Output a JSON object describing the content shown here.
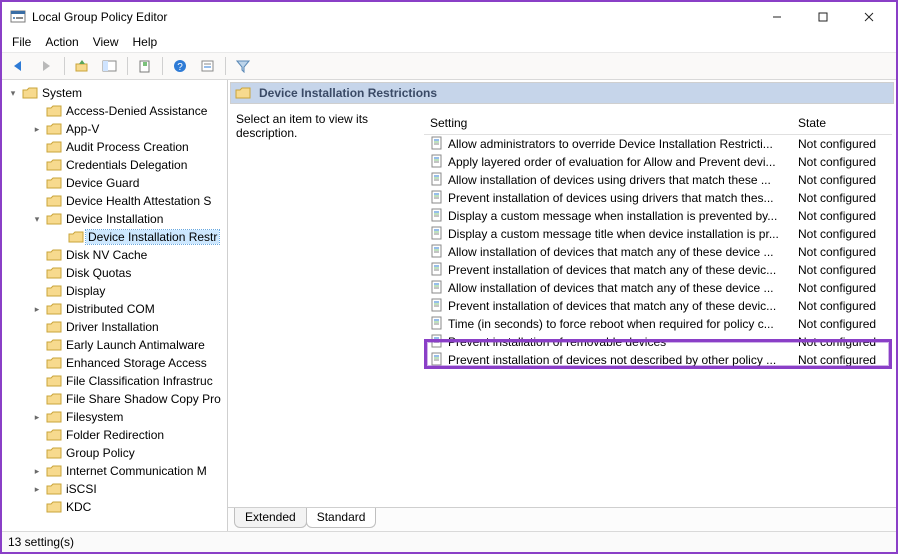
{
  "window": {
    "title": "Local Group Policy Editor"
  },
  "menu": {
    "file": "File",
    "action": "Action",
    "view": "View",
    "help": "Help"
  },
  "tree": {
    "root": "System",
    "root_expanded": true,
    "items": [
      {
        "label": "Access-Denied Assistance",
        "twisty": " "
      },
      {
        "label": "App-V",
        "twisty": ">"
      },
      {
        "label": "Audit Process Creation",
        "twisty": " "
      },
      {
        "label": "Credentials Delegation",
        "twisty": " "
      },
      {
        "label": "Device Guard",
        "twisty": " "
      },
      {
        "label": "Device Health Attestation S",
        "twisty": " "
      },
      {
        "label": "Device Installation",
        "twisty": "v",
        "expanded": true
      },
      {
        "label": "Device Installation Restr",
        "twisty": " ",
        "child": true,
        "selected": true
      },
      {
        "label": "Disk NV Cache",
        "twisty": " "
      },
      {
        "label": "Disk Quotas",
        "twisty": " "
      },
      {
        "label": "Display",
        "twisty": " "
      },
      {
        "label": "Distributed COM",
        "twisty": ">"
      },
      {
        "label": "Driver Installation",
        "twisty": " "
      },
      {
        "label": "Early Launch Antimalware",
        "twisty": " "
      },
      {
        "label": "Enhanced Storage Access",
        "twisty": " "
      },
      {
        "label": "File Classification Infrastruc",
        "twisty": " "
      },
      {
        "label": "File Share Shadow Copy Pro",
        "twisty": " "
      },
      {
        "label": "Filesystem",
        "twisty": ">"
      },
      {
        "label": "Folder Redirection",
        "twisty": " "
      },
      {
        "label": "Group Policy",
        "twisty": " "
      },
      {
        "label": "Internet Communication M",
        "twisty": ">"
      },
      {
        "label": "iSCSI",
        "twisty": ">"
      },
      {
        "label": "KDC",
        "twisty": " "
      }
    ]
  },
  "detail": {
    "header": "Device Installation Restrictions",
    "hint": "Select an item to view its description.",
    "columns": {
      "setting": "Setting",
      "state": "State"
    },
    "rows": [
      {
        "setting": "Allow administrators to override Device Installation Restricti...",
        "state": "Not configured"
      },
      {
        "setting": "Apply layered order of evaluation for Allow and Prevent devi...",
        "state": "Not configured"
      },
      {
        "setting": "Allow installation of devices using drivers that match these ...",
        "state": "Not configured"
      },
      {
        "setting": "Prevent installation of devices using drivers that match thes...",
        "state": "Not configured"
      },
      {
        "setting": "Display a custom message when installation is prevented by...",
        "state": "Not configured"
      },
      {
        "setting": "Display a custom message title when device installation is pr...",
        "state": "Not configured"
      },
      {
        "setting": "Allow installation of devices that match any of these device ...",
        "state": "Not configured"
      },
      {
        "setting": "Prevent installation of devices that match any of these devic...",
        "state": "Not configured"
      },
      {
        "setting": "Allow installation of devices that match any of these device ...",
        "state": "Not configured"
      },
      {
        "setting": "Prevent installation of devices that match any of these devic...",
        "state": "Not configured"
      },
      {
        "setting": "Time (in seconds) to force reboot when required for policy c...",
        "state": "Not configured"
      },
      {
        "setting": "Prevent installation of removable devices",
        "state": "Not configured"
      },
      {
        "setting": "Prevent installation of devices not described by other policy ...",
        "state": "Not configured",
        "highlight": true
      }
    ],
    "tabs": {
      "t1": "Extended",
      "t2": "Standard"
    }
  },
  "status": {
    "text": "13 setting(s)"
  }
}
